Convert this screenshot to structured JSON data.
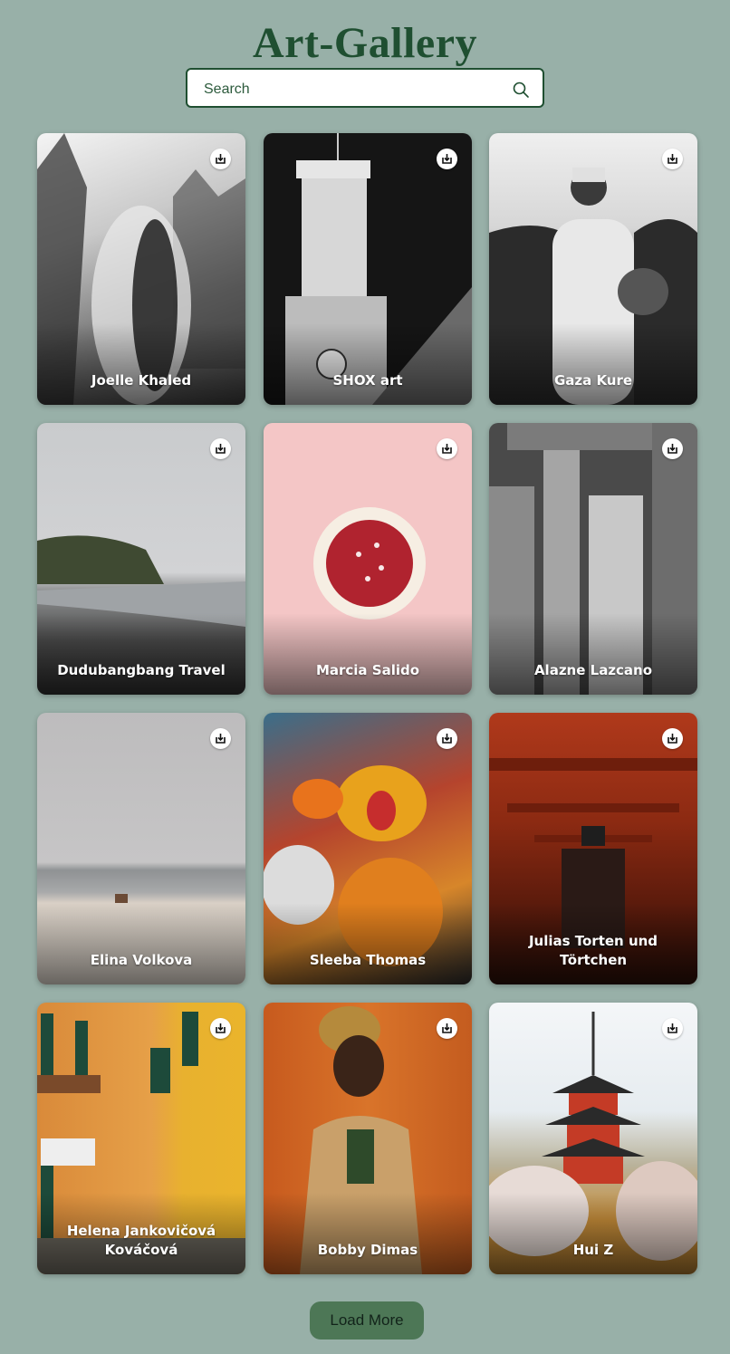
{
  "app": {
    "title": "Art-Gallery"
  },
  "search": {
    "placeholder": "Search",
    "value": ""
  },
  "gallery": {
    "items": [
      {
        "photographer": "Joelle Khaled",
        "icon": "download-icon"
      },
      {
        "photographer": "SHOX art",
        "icon": "download-icon"
      },
      {
        "photographer": "Gaza Kure",
        "icon": "download-icon"
      },
      {
        "photographer": "Dudubangbang Travel",
        "icon": "download-icon"
      },
      {
        "photographer": "Marcia Salido",
        "icon": "download-icon"
      },
      {
        "photographer": "Alazne Lazcano",
        "icon": "download-icon"
      },
      {
        "photographer": "Elina Volkova",
        "icon": "download-icon"
      },
      {
        "photographer": "Sleeba Thomas",
        "icon": "download-icon"
      },
      {
        "photographer": "Julias Torten und Törtchen",
        "icon": "download-icon"
      },
      {
        "photographer": "Helena Jankovičová Kováčová",
        "icon": "download-icon"
      },
      {
        "photographer": "Bobby Dimas",
        "icon": "download-icon"
      },
      {
        "photographer": "Hui Z",
        "icon": "download-icon"
      }
    ]
  },
  "load_more": {
    "label": "Load More"
  },
  "colors": {
    "background": "#98b0a8",
    "accent": "#1f4f31",
    "button": "#4d7756"
  }
}
